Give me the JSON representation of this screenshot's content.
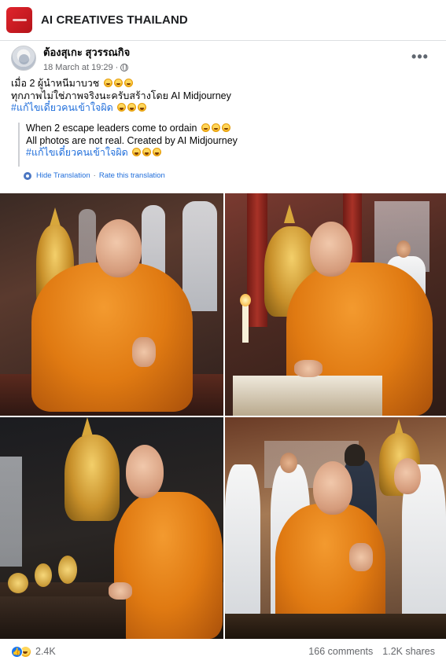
{
  "page": {
    "name": "AI CREATIVES THAILAND"
  },
  "post": {
    "author": "ต้องสุเกะ สุวรรณกิจ",
    "timestamp": "18 March at 19:29",
    "meta_separator": "·",
    "more_label": "•••",
    "text_line_1": "เมื่อ 2 ผู้นำหนีมาบวช",
    "text_line_2": "ทุกภาพไม่ใช่ภาพจริงนะครับสร้างโดย AI Midjourney",
    "hashtag": "#แก้ไขเดี๋ยวคนเข้าใจผิด",
    "translation": {
      "line_1": "When 2 escape leaders come to ordain",
      "line_2": "All photos are not real. Created by AI Midjourney",
      "hashtag": "#แก้ไขเดี๋ยวคนเข้าใจผิด"
    },
    "hide_translation": "Hide Translation",
    "link_separator": "·",
    "rate_translation": "Rate this translation"
  },
  "photos": [
    {
      "icon": "photo-monk-temple-1"
    },
    {
      "icon": "photo-monk-temple-2"
    },
    {
      "icon": "photo-monk-temple-3"
    },
    {
      "icon": "photo-monk-temple-4"
    }
  ],
  "footer": {
    "like_symbol": "👍",
    "reaction_count": "2.4K",
    "comments": "166 comments",
    "shares": "1.2K shares"
  },
  "colors": {
    "link": "#216fdb",
    "like": "#1877f2",
    "brand": "#e0242c",
    "robe": "#e07a12"
  }
}
